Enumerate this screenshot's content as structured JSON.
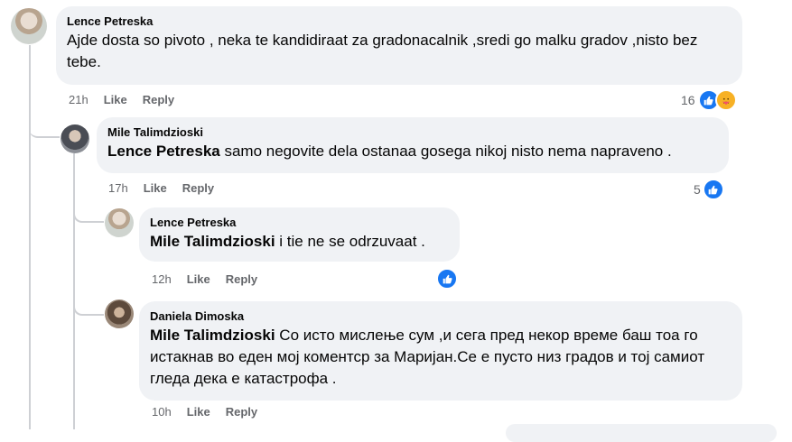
{
  "comments": [
    {
      "author": "Lence Petreska",
      "text": "Ajde dosta so pivoto , neka te kandidiraat za gradonacalnik ,sredi go malku gradov ,nisto bez tebe.",
      "time": "21h",
      "like": "Like",
      "reply": "Reply",
      "reaction_count": "16",
      "reactions": [
        "like-icon",
        "care-icon"
      ]
    },
    {
      "author": "Mile Talimdzioski",
      "mention": "Lence Petreska",
      "text": " samo negovite dela ostanaa gosega nikoj nisto nema napraveno .",
      "time": "17h",
      "like": "Like",
      "reply": "Reply",
      "reaction_count": "5",
      "reactions": [
        "like-icon"
      ]
    },
    {
      "author": "Lence Petreska",
      "mention": "Mile Talimdzioski",
      "text": " i tie ne se odrzuvaat .",
      "time": "12h",
      "like": "Like",
      "reply": "Reply",
      "reaction_count": "",
      "reactions": [
        "like-icon"
      ]
    },
    {
      "author": "Daniela Dimoska",
      "mention": "Mile Talimdzioski",
      "text": " Со исто мислење сум ,и сега пред некор време баш тоа го истакнав во еден мој коментср за Маријан.Се е пусто низ градов и тој самиот гледа дека е катастрофа .",
      "time": "10h",
      "like": "Like",
      "reply": "Reply",
      "reaction_count": "",
      "reactions": []
    }
  ],
  "colors": {
    "bubble": "#f0f2f5",
    "meta": "#65676b",
    "like_blue": "#1877f2",
    "thread_line": "#ced0d4"
  }
}
